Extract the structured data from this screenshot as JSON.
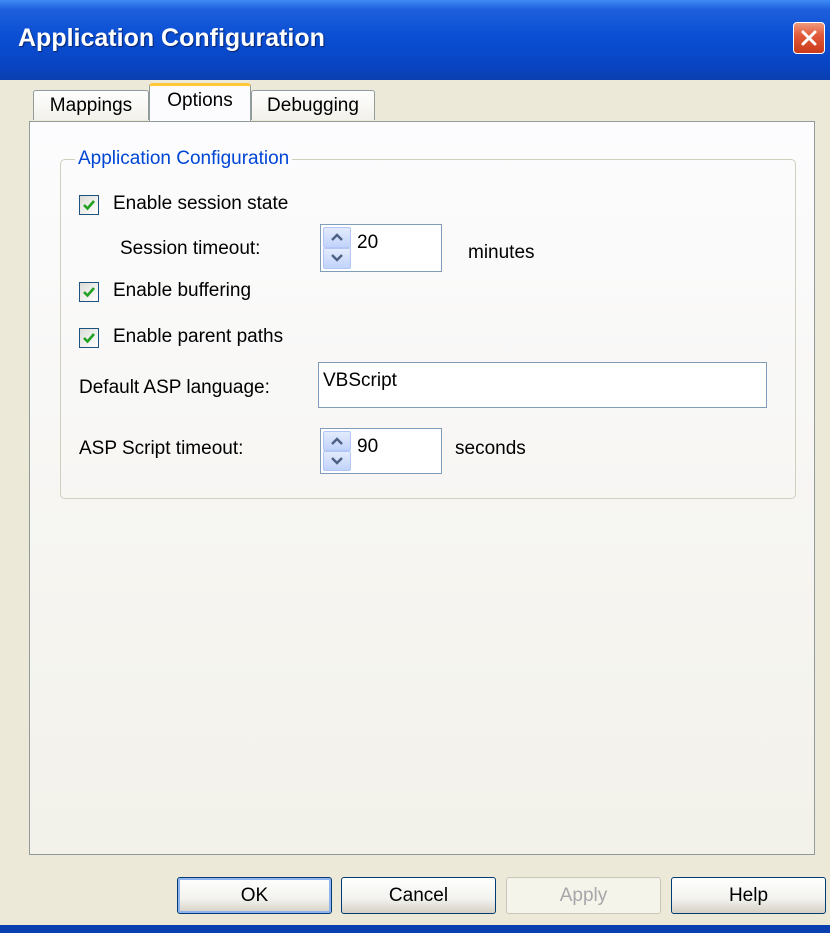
{
  "window": {
    "title": "Application Configuration",
    "close_icon": "close-icon"
  },
  "tabs": [
    {
      "label": "Mappings",
      "active": false
    },
    {
      "label": "Options",
      "active": true
    },
    {
      "label": "Debugging",
      "active": false
    }
  ],
  "group": {
    "title": "Application Configuration"
  },
  "options": {
    "enable_session_state": {
      "label": "Enable session state",
      "checked": true
    },
    "session_timeout": {
      "label": "Session timeout:",
      "value": "20",
      "unit": "minutes"
    },
    "enable_buffering": {
      "label": "Enable buffering",
      "checked": true
    },
    "enable_parent_paths": {
      "label": "Enable parent paths",
      "checked": true
    },
    "default_language": {
      "label": "Default ASP language:",
      "value": "VBScript"
    },
    "script_timeout": {
      "label": "ASP Script timeout:",
      "value": "90",
      "unit": "seconds"
    }
  },
  "buttons": {
    "ok": "OK",
    "cancel": "Cancel",
    "apply": "Apply",
    "help": "Help"
  },
  "colors": {
    "titlebar": "#0a4fd4",
    "group_title": "#0046d5",
    "tab_highlight": "#ffc83c",
    "check_mark": "#21a121"
  }
}
